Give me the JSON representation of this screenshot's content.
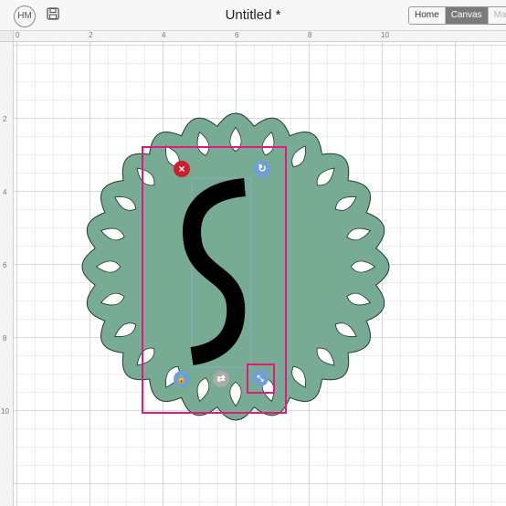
{
  "header": {
    "avatar_initials": "HM",
    "save_icon": "floppy-disk-icon",
    "title": "Untitled *",
    "tabs": [
      "Home",
      "Canvas",
      "Make"
    ],
    "active_tab": "Canvas"
  },
  "ruler": {
    "top_labels": [
      "0",
      "2",
      "4",
      "6",
      "8",
      "10"
    ],
    "left_labels": [
      "2",
      "4",
      "6",
      "8",
      "10"
    ]
  },
  "canvas": {
    "doily_color": "#78ab94",
    "letter_color": "#000000",
    "selection_color": "#e3187a"
  },
  "handles": {
    "delete": "×",
    "rotate": "↻",
    "lock": "🔒",
    "flip": "⇄",
    "resize": "⤡"
  }
}
